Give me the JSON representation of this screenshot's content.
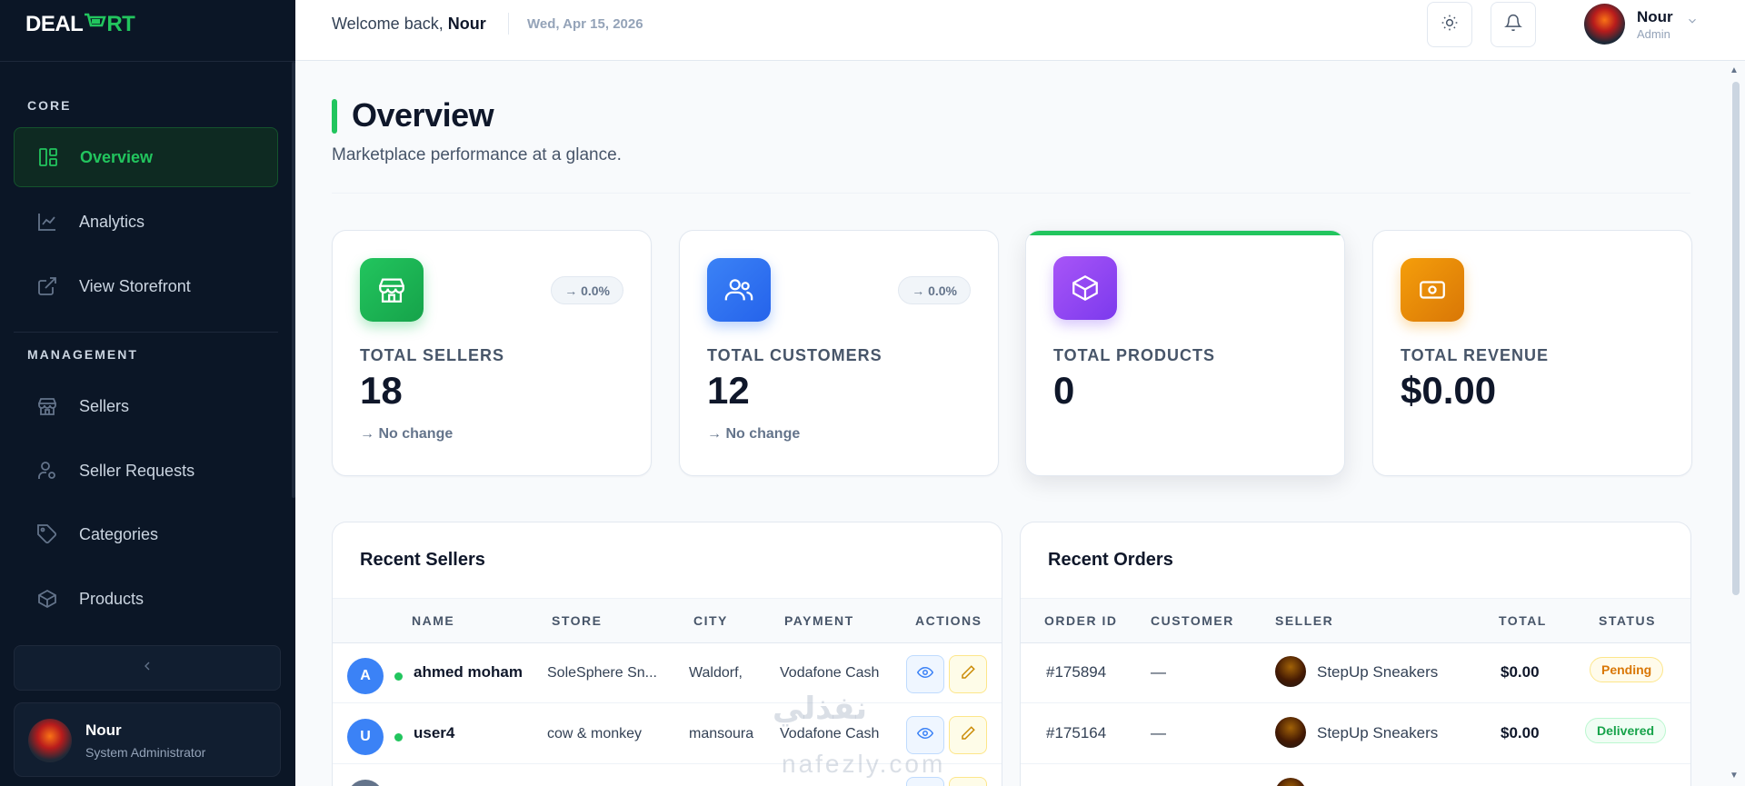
{
  "app": {
    "logo_prefix": "DEAL",
    "logo_mid": "M",
    "logo_suffix": "RT"
  },
  "sidebar": {
    "sections": [
      {
        "label": "CORE"
      },
      {
        "label": "MANAGEMENT"
      }
    ],
    "items": [
      {
        "label": "Overview",
        "icon": "layout-dashboard-icon",
        "active": true
      },
      {
        "label": "Analytics",
        "icon": "chart-line-icon"
      },
      {
        "label": "View Storefront",
        "icon": "external-link-icon"
      },
      {
        "label": "Sellers",
        "icon": "store-icon"
      },
      {
        "label": "Seller Requests",
        "icon": "user-check-icon"
      },
      {
        "label": "Categories",
        "icon": "tag-icon"
      },
      {
        "label": "Products",
        "icon": "box-icon"
      }
    ],
    "collapse_icon": "chevron-left-icon",
    "profile": {
      "name": "Nour",
      "role": "System Administrator"
    }
  },
  "header": {
    "welcome_prefix": "Welcome back, ",
    "welcome_name": "Nour",
    "date": "Wed, Apr 15, 2026",
    "theme_icon": "sun-icon",
    "notify_icon": "bell-icon",
    "user": {
      "name": "Nour",
      "role": "Admin"
    }
  },
  "page": {
    "title": "Overview",
    "subtitle": "Marketplace performance at a glance."
  },
  "stats": [
    {
      "label": "TOTAL SELLERS",
      "value": "18",
      "badge": "→ 0.0%",
      "change": "→ No change",
      "color": "#22c55e",
      "icon": "store-icon"
    },
    {
      "label": "TOTAL CUSTOMERS",
      "value": "12",
      "badge": "→ 0.0%",
      "change": "→ No change",
      "color": "#3b82f6",
      "icon": "users-icon"
    },
    {
      "label": "TOTAL PRODUCTS",
      "value": "0",
      "color": "#8b5cf6",
      "icon": "box-icon"
    },
    {
      "label": "TOTAL REVENUE",
      "value": "$0.00",
      "color": "#f59e0b",
      "icon": "banknote-icon"
    }
  ],
  "recent_sellers": {
    "title": "Recent Sellers",
    "columns": [
      "NAME",
      "STORE",
      "CITY",
      "PAYMENT",
      "ACTIONS"
    ],
    "rows": [
      {
        "initial": "A",
        "name": "ahmed moham",
        "store": "SoleSphere Sn...",
        "city": "Waldorf,",
        "payment": "Vodafone Cash"
      },
      {
        "initial": "U",
        "name": "user4",
        "store": "cow & monkey",
        "city": "mansoura",
        "payment": "Vodafone Cash"
      }
    ]
  },
  "recent_orders": {
    "title": "Recent Orders",
    "columns": [
      "ORDER ID",
      "CUSTOMER",
      "SELLER",
      "TOTAL",
      "STATUS"
    ],
    "rows": [
      {
        "id": "#175894",
        "customer": "—",
        "seller": "StepUp Sneakers",
        "total": "$0.00",
        "status": "Pending"
      },
      {
        "id": "#175164",
        "customer": "—",
        "seller": "StepUp Sneakers",
        "total": "$0.00",
        "status": "Delivered"
      }
    ]
  },
  "watermark": {
    "arabic": "نفذلي",
    "latin": "nafezly.com"
  }
}
